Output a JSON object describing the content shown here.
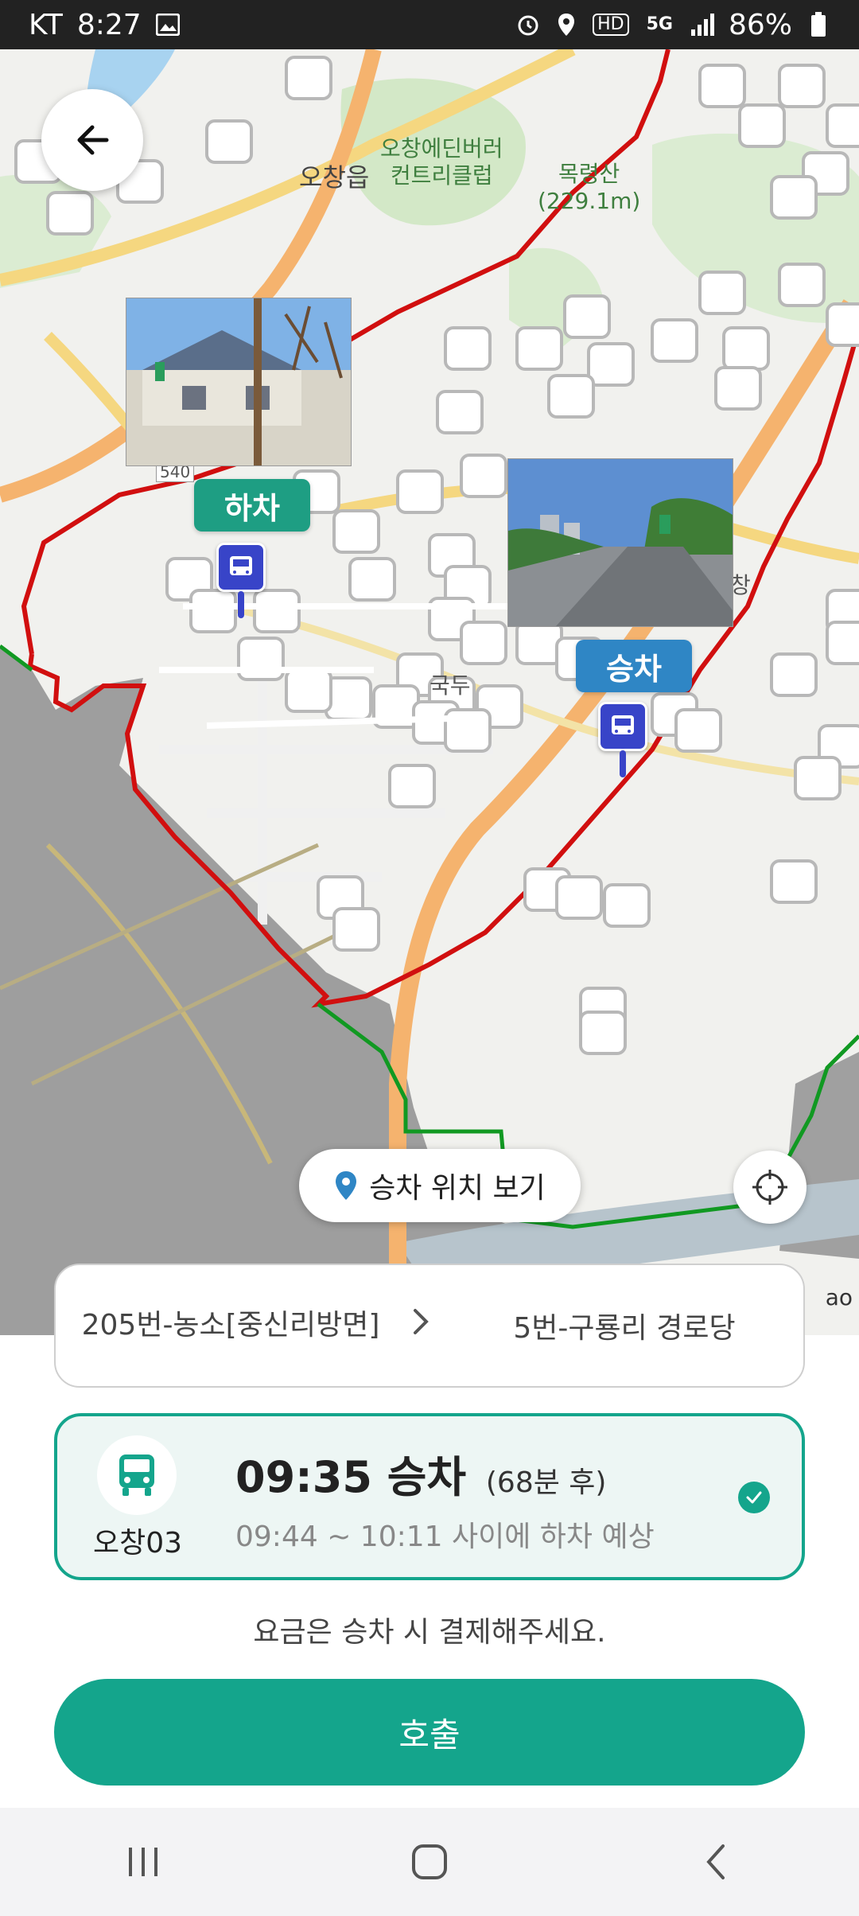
{
  "status_bar": {
    "carrier": "KT",
    "time": "8:27",
    "battery": "86%",
    "hd_label": "HD",
    "network_label": "5G"
  },
  "map": {
    "labels": {
      "town": "오창읍",
      "country_club": "오창에딘버러\n컨트리클럽",
      "mountain": "목령산\n(229.1m)",
      "road_number": "540",
      "place_1": "국두",
      "place_2": "창",
      "attribution": "ao"
    },
    "dropoff_tag": "하차",
    "pickup_tag": "승차",
    "pickup_view_button": "승차 위치 보기",
    "colors": {
      "service_area": "#cc1111",
      "green_boundary": "#119922",
      "dropoff_tag": "#1e9e83",
      "pickup_tag": "#2f86c5",
      "stop_pin": "#3844c8"
    }
  },
  "route": {
    "from": "205번-농소[중신리방면]",
    "to": "5번-구룡리 경로당"
  },
  "option": {
    "bus_name": "오창03",
    "departure": "09:35 승차",
    "wait": "(68분 후)",
    "arrival_range": "09:44 ~ 10:11 사이에 하차 예상",
    "selected": true,
    "accent_color": "#14a58c"
  },
  "fare_note": "요금은 승차 시 결제해주세요.",
  "call_button": "호출",
  "nav": {
    "recent": "recent-apps",
    "home": "home",
    "back": "back"
  }
}
